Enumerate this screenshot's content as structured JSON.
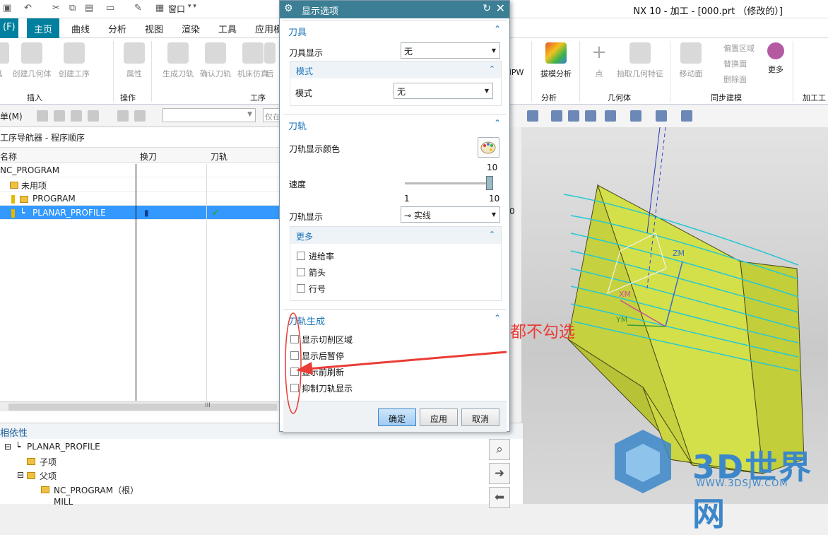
{
  "window": {
    "title": "NX 10 - 加工 - [000.prt （修改的）]",
    "window_menu": "窗口"
  },
  "ribbon": {
    "file_tab": "(F)",
    "tabs": [
      "主页",
      "曲线",
      "分析",
      "视图",
      "渲染",
      "工具",
      "应用模"
    ],
    "buttons": [
      "具",
      "创建几何体",
      "创建工序",
      "属性",
      "生成刀轨",
      "确认刀轨",
      "机床仿真",
      "后",
      "IPW",
      "拔模分析",
      "点",
      "抽取几何特征",
      "移动面",
      "更多"
    ],
    "side_items": [
      "偏置区域",
      "替换面",
      "删除面"
    ],
    "groups": [
      "插入",
      "操作",
      "工序",
      "分析",
      "几何体",
      "同步建模",
      "加工工具"
    ]
  },
  "toolbar": {
    "menu_label": "单(M)",
    "filter_hint": "仅在"
  },
  "navigator": {
    "title": "工序导航器 - 程序顺序",
    "columns": [
      "名称",
      "换刀",
      "刀轨"
    ],
    "rows": [
      {
        "name": "NC_PROGRAM"
      },
      {
        "name": "未用项"
      },
      {
        "name": "PROGRAM"
      },
      {
        "name": "PLANAR_PROFILE",
        "toolpath_status": "✔"
      }
    ],
    "edge_value": "0",
    "scroll_mark": "III"
  },
  "dependencies": {
    "title": "相依性",
    "items": [
      "PLANAR_PROFILE",
      "子项",
      "父项",
      "NC_PROGRAM（根）",
      "MILL"
    ]
  },
  "dialog": {
    "title": "显示选项",
    "tool_section": {
      "title": "刀具",
      "tool_display_label": "刀具显示",
      "tool_display_value": "无",
      "mode_sub": {
        "title": "模式",
        "mode_label": "模式",
        "mode_value": "无"
      }
    },
    "path_section": {
      "title": "刀轨",
      "color_label": "刀轨显示颜色",
      "speed_label": "速度",
      "speed_value": "10",
      "speed_min": "1",
      "speed_max": "10",
      "speed_fraction": 1.0,
      "path_display_label": "刀轨显示",
      "path_display_value": "实线",
      "more_sub": {
        "title": "更多",
        "options": [
          "进给率",
          "箭头",
          "行号"
        ]
      }
    },
    "gen_section": {
      "title": "刀轨生成",
      "options": [
        "显示切削区域",
        "显示后暂停",
        "显示前刷新",
        "抑制刀轨显示"
      ]
    },
    "buttons": {
      "ok": "确定",
      "apply": "应用",
      "cancel": "取消"
    }
  },
  "graphics": {
    "axis_zm": "ZM",
    "axis_xm": "XM",
    "axis_ym": "YM"
  },
  "annotation": {
    "note": "都不勾选",
    "color": "#ea3c36"
  },
  "watermark": {
    "brand": "3D世界网",
    "url": "WWW.3DSJW.COM",
    "color": "#3c87c9"
  },
  "colors": {
    "accent": "#00809e",
    "selection": "#3399ff",
    "part": "#d3e04a"
  }
}
